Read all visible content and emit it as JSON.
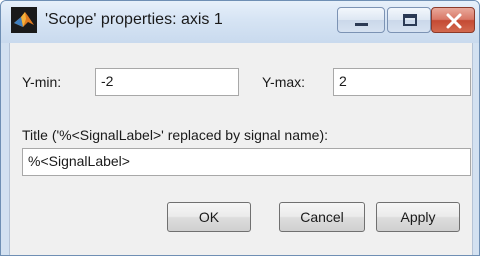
{
  "window": {
    "title": "'Scope' properties: axis 1",
    "icon": "matlab-membrane-icon",
    "controls": {
      "minimize_icon": "minimize-icon",
      "maximize_icon": "maximize-icon",
      "close_icon": "close-icon"
    },
    "accent_colors": {
      "title_bar": "#d6e4f4",
      "close_button": "#c44a33",
      "client_bg": "#f0f0f0"
    }
  },
  "form": {
    "ymin_label": "Y-min:",
    "ymin_value": "-2",
    "ymax_label": "Y-max:",
    "ymax_value": "2",
    "title_label": "Title ('%<SignalLabel>' replaced by signal name):",
    "title_value": "%<SignalLabel>"
  },
  "buttons": {
    "ok": "OK",
    "cancel": "Cancel",
    "apply": "Apply"
  }
}
